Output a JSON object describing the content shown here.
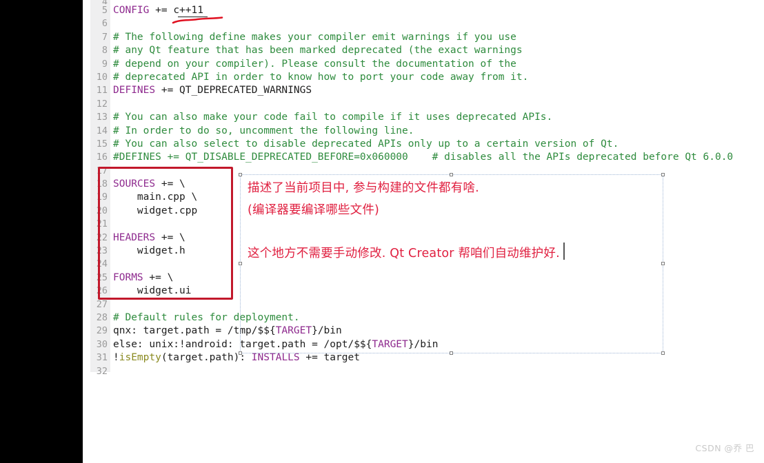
{
  "editor": {
    "first_partial_line": "4",
    "lines": [
      {
        "no": "5",
        "segments": [
          {
            "t": "var",
            "s": "CONFIG"
          },
          {
            "t": "plain",
            "s": " += "
          },
          {
            "t": "plain",
            "s": "c++11"
          }
        ]
      },
      {
        "no": "6",
        "segments": [
          {
            "t": "plain",
            "s": ""
          }
        ]
      },
      {
        "no": "7",
        "segments": [
          {
            "t": "comment",
            "s": "# The following define makes your compiler emit warnings if you use"
          }
        ]
      },
      {
        "no": "8",
        "segments": [
          {
            "t": "comment",
            "s": "# any Qt feature that has been marked deprecated (the exact warnings"
          }
        ]
      },
      {
        "no": "9",
        "segments": [
          {
            "t": "comment",
            "s": "# depend on your compiler). Please consult the documentation of the"
          }
        ]
      },
      {
        "no": "10",
        "segments": [
          {
            "t": "comment",
            "s": "# deprecated API in order to know how to port your code away from it."
          }
        ]
      },
      {
        "no": "11",
        "segments": [
          {
            "t": "var",
            "s": "DEFINES"
          },
          {
            "t": "plain",
            "s": " += QT_DEPRECATED_WARNINGS"
          }
        ]
      },
      {
        "no": "12",
        "segments": [
          {
            "t": "plain",
            "s": ""
          }
        ]
      },
      {
        "no": "13",
        "segments": [
          {
            "t": "comment",
            "s": "# You can also make your code fail to compile if it uses deprecated APIs."
          }
        ]
      },
      {
        "no": "14",
        "segments": [
          {
            "t": "comment",
            "s": "# In order to do so, uncomment the following line."
          }
        ]
      },
      {
        "no": "15",
        "segments": [
          {
            "t": "comment",
            "s": "# You can also select to disable deprecated APIs only up to a certain version of Qt."
          }
        ]
      },
      {
        "no": "16",
        "segments": [
          {
            "t": "comment",
            "s": "#DEFINES += QT_DISABLE_DEPRECATED_BEFORE=0x060000    # disables all the APIs deprecated before Qt 6.0.0"
          }
        ]
      },
      {
        "no": "17",
        "segments": [
          {
            "t": "plain",
            "s": ""
          }
        ]
      },
      {
        "no": "18",
        "segments": [
          {
            "t": "var",
            "s": "SOURCES"
          },
          {
            "t": "plain",
            "s": " += \\"
          }
        ]
      },
      {
        "no": "19",
        "segments": [
          {
            "t": "plain",
            "s": "    main.cpp \\"
          }
        ]
      },
      {
        "no": "20",
        "segments": [
          {
            "t": "plain",
            "s": "    widget.cpp"
          }
        ]
      },
      {
        "no": "21",
        "segments": [
          {
            "t": "plain",
            "s": ""
          }
        ]
      },
      {
        "no": "22",
        "segments": [
          {
            "t": "var",
            "s": "HEADERS"
          },
          {
            "t": "plain",
            "s": " += \\"
          }
        ]
      },
      {
        "no": "23",
        "segments": [
          {
            "t": "plain",
            "s": "    widget.h"
          }
        ]
      },
      {
        "no": "24",
        "segments": [
          {
            "t": "plain",
            "s": ""
          }
        ]
      },
      {
        "no": "25",
        "segments": [
          {
            "t": "var",
            "s": "FORMS"
          },
          {
            "t": "plain",
            "s": " += \\"
          }
        ]
      },
      {
        "no": "26",
        "segments": [
          {
            "t": "plain",
            "s": "    widget.ui"
          }
        ]
      },
      {
        "no": "27",
        "segments": [
          {
            "t": "plain",
            "s": ""
          }
        ]
      },
      {
        "no": "28",
        "segments": [
          {
            "t": "comment",
            "s": "# Default rules for deployment."
          }
        ]
      },
      {
        "no": "29",
        "segments": [
          {
            "t": "plain",
            "s": "qnx: target.path = /tmp/$${"
          },
          {
            "t": "var",
            "s": "TARGET"
          },
          {
            "t": "plain",
            "s": "}/bin"
          }
        ]
      },
      {
        "no": "30",
        "segments": [
          {
            "t": "plain",
            "s": "else: unix:!android: target.path = /opt/$${"
          },
          {
            "t": "var",
            "s": "TARGET"
          },
          {
            "t": "plain",
            "s": "}/bin"
          }
        ]
      },
      {
        "no": "31",
        "segments": [
          {
            "t": "plain",
            "s": "!"
          },
          {
            "t": "func",
            "s": "isEmpty"
          },
          {
            "t": "plain",
            "s": "(target.path): "
          },
          {
            "t": "var",
            "s": "INSTALLS"
          },
          {
            "t": "plain",
            "s": " += target"
          }
        ]
      },
      {
        "no": "32",
        "segments": [
          {
            "t": "plain",
            "s": ""
          }
        ]
      }
    ]
  },
  "annotations": {
    "line_1": "描述了当前项目中, 参与构建的文件都有啥.",
    "line_2": "(编译器要编译哪些文件)",
    "line_3": "这个地方不需要手动修改. Qt Creator 帮咱们自动维护好.",
    "text_color": "#e02040",
    "highlight_box_color": "#c2182b",
    "selection_border_color": "#9fb6d6"
  },
  "watermark": {
    "text": "CSDN @乔 巴"
  },
  "colors": {
    "background": "#ffffff",
    "gutter": "#efeff0",
    "line_number": "#9a9a9a",
    "comment": "#2e8b3d",
    "variable": "#8e2a8e",
    "function": "#8a8a20",
    "plain": "#1d1d1d",
    "left_bar": "#000000"
  }
}
